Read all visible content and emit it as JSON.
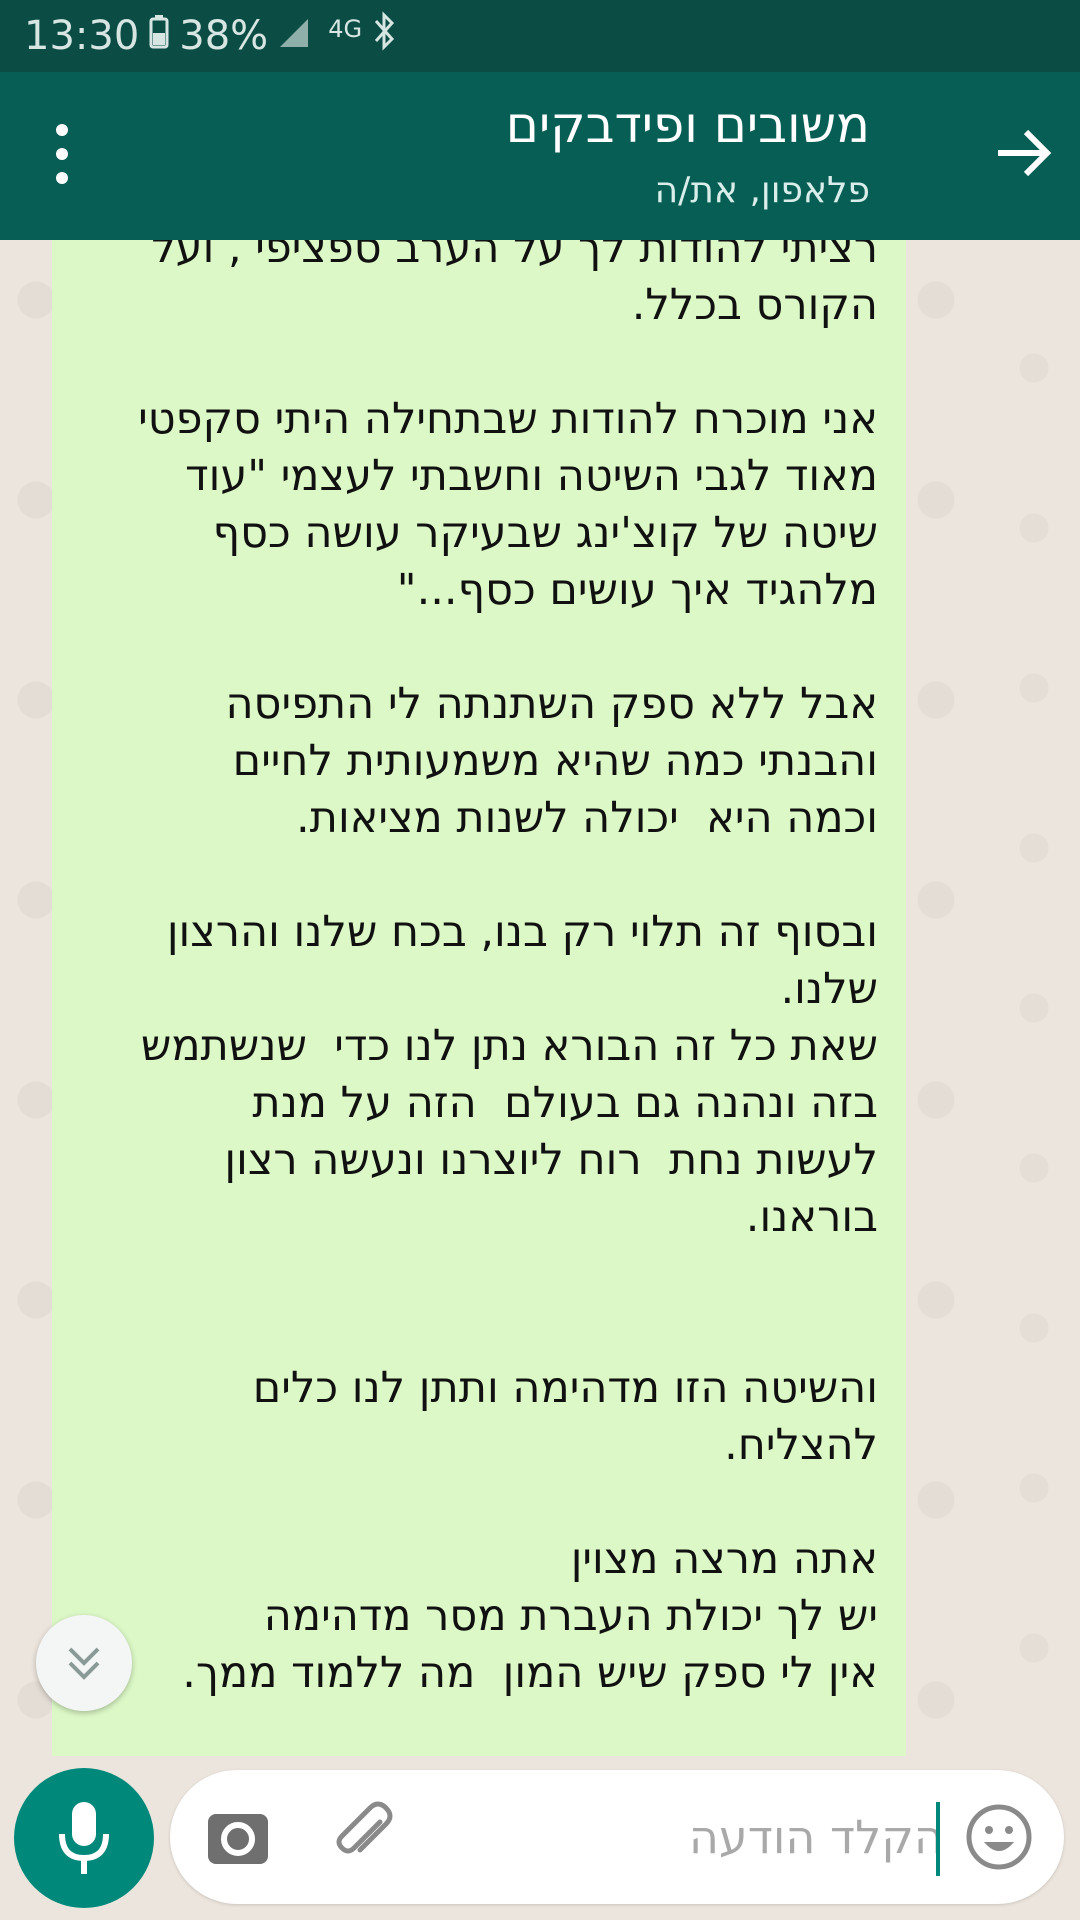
{
  "status_bar": {
    "time": "13:30",
    "battery": "38%",
    "network": "4G"
  },
  "header": {
    "title": "משובים ופידבקים",
    "subtitle": "פלאפון, את/ה"
  },
  "message": {
    "text": "רציתי להודות לך על הערב ספציפי , ועל\nהקורס בכלל.\n\nאני מוכרח להודות שבתחילה היתי סקפטי\nמאוד לגבי השיטה וחשבתי לעצמי \"עוד\nשיטה של קוצ'ינג שבעיקר עושה כסף\nמלהגיד איך עושים כסף...\"\n\nאבל ללא ספק השתנתה לי התפיסה\nוהבנתי כמה שהיא משמעותית לחיים\nוכמה היא  יכולה לשנות מציאות.\n\nובסוף זה תלוי רק בנו, בכח שלנו והרצון\nשלנו.\nשאת כל זה הבורא נתן לנו כדי  שנשתמש\nבזה ונהנה גם בעולם  הזה על מנת\nלעשות נחת  רוח ליוצרנו ונעשה רצון\nבוראנו.\n\n\nוהשיטה הזו מדהימה ותתן לנו כלים\nלהצליח.\n\nאתה מרצה מצוין\nיש לך יכולת העברת מסר מדהימה\nאין לי ספק שיש המון  מה ללמוד ממך."
  },
  "input": {
    "placeholder": "הקלד הודעה"
  },
  "icons": {
    "menu": "more-vert-icon",
    "back": "arrow-forward-icon",
    "scroll": "double-chevron-down-icon",
    "mic": "mic-icon",
    "camera": "camera-icon",
    "attach": "paperclip-icon",
    "emoji": "emoji-icon"
  },
  "colors": {
    "header": "#075e54",
    "status_bar": "#0b4d45",
    "bubble": "#dcf8c6",
    "accent": "#00897b"
  }
}
